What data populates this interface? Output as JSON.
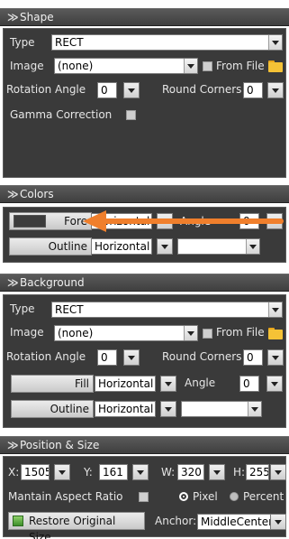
{
  "shape": {
    "header": "Shape",
    "type_label": "Type",
    "type_value": "RECT",
    "image_label": "Image",
    "image_value": "(none)",
    "from_file_label": "From File",
    "rotation_label": "Rotation Angle",
    "rotation_value": "0",
    "round_corners_label": "Round Corners",
    "round_corners_value": "0",
    "gamma_label": "Gamma Correction"
  },
  "colors": {
    "header": "Colors",
    "fore_label": "Fore",
    "fore_mode": "Horizontal",
    "angle_label": "Angle",
    "angle_value": "0",
    "outline_label": "Outline",
    "outline_mode": "Horizontal",
    "outline_value": "",
    "fore_swatch_color": "#3c3c3c",
    "annotation_arrow_color": "#f07f2c"
  },
  "background": {
    "header": "Background",
    "type_label": "Type",
    "type_value": "RECT",
    "image_label": "Image",
    "image_value": "(none)",
    "from_file_label": "From File",
    "rotation_label": "Rotation Angle",
    "rotation_value": "0",
    "round_corners_label": "Round Corners",
    "round_corners_value": "0",
    "fill_label": "Fill",
    "fill_mode": "Horizontal",
    "angle_label": "Angle",
    "angle_value": "0",
    "outline_label": "Outline",
    "outline_mode": "Horizontal",
    "outline_value": ""
  },
  "position": {
    "header": "Position & Size",
    "x_label": "X:",
    "x_value": "1505",
    "y_label": "Y:",
    "y_value": "161",
    "w_label": "W:",
    "w_value": "320",
    "h_label": "H:",
    "h_value": "255",
    "aspect_label": "Mantain Aspect Ratio",
    "pixel_label": "Pixel",
    "percent_label": "Percent",
    "selected_unit": "Pixel",
    "restore_label": "Restore Original Size",
    "anchor_label": "Anchor:",
    "anchor_value": "MiddleCenter"
  },
  "collapse_glyph": "≫"
}
